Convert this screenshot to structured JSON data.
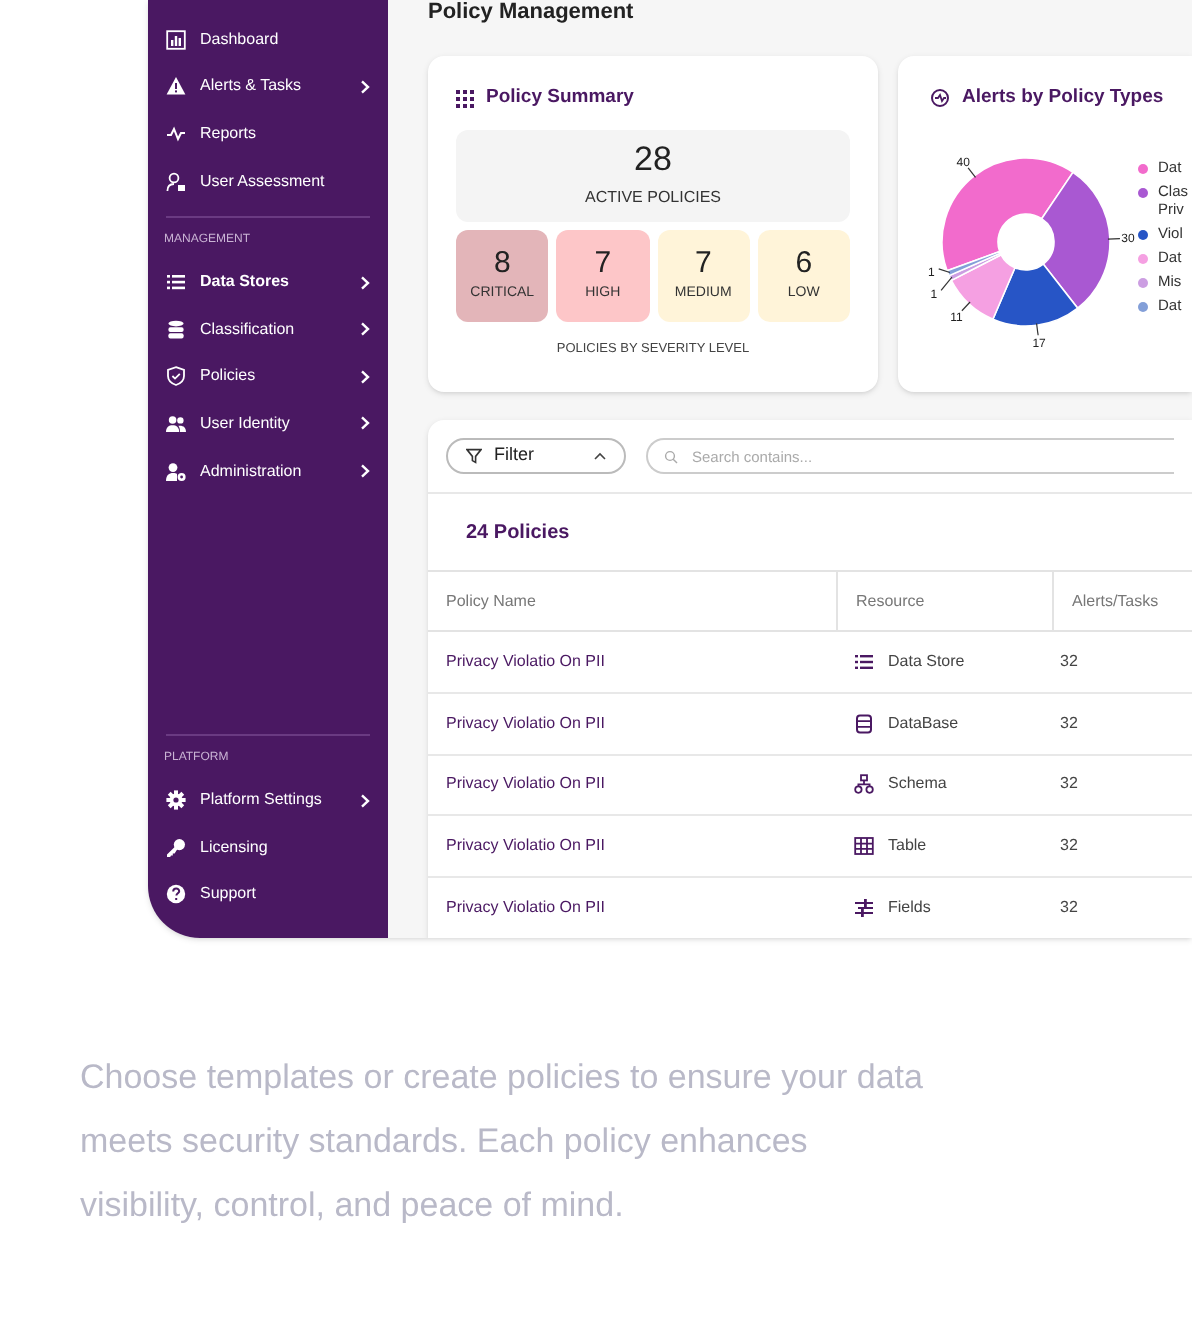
{
  "sidebar": {
    "sections": [
      {
        "items": [
          {
            "label": "Dashboard",
            "has_submenu": false,
            "selected": false
          },
          {
            "label": "Alerts & Tasks",
            "has_submenu": true,
            "selected": false
          },
          {
            "label": "Reports",
            "has_submenu": false,
            "selected": false
          },
          {
            "label": "User Assessment",
            "has_submenu": false,
            "selected": false
          }
        ]
      },
      {
        "title": "MANAGEMENT",
        "items": [
          {
            "label": "Data Stores",
            "has_submenu": true,
            "selected": true
          },
          {
            "label": "Classification",
            "has_submenu": true,
            "selected": false
          },
          {
            "label": "Policies",
            "has_submenu": true,
            "selected": false
          },
          {
            "label": "User Identity",
            "has_submenu": true,
            "selected": false
          },
          {
            "label": "Administration",
            "has_submenu": true,
            "selected": false
          }
        ]
      },
      {
        "title": "PLATFORM",
        "items": [
          {
            "label": "Platform Settings",
            "has_submenu": true,
            "selected": false
          },
          {
            "label": "Licensing",
            "has_submenu": false,
            "selected": false
          },
          {
            "label": "Support",
            "has_submenu": false,
            "selected": false
          }
        ]
      }
    ]
  },
  "page_title": "Policy Management",
  "policy_summary": {
    "title": "Policy Summary",
    "total": "28",
    "total_label": "ACTIVE POLICIES",
    "severities": [
      {
        "count": "8",
        "label": "CRITICAL",
        "color": "#e3b5b9"
      },
      {
        "count": "7",
        "label": "HIGH",
        "color": "#fdc6c8"
      },
      {
        "count": "7",
        "label": "MEDIUM",
        "color": "#fff4d9"
      },
      {
        "count": "6",
        "label": "LOW",
        "color": "#fff4d9"
      }
    ],
    "footer": "POLICIES BY SEVERITY LEVEL"
  },
  "alerts_chart": {
    "title": "Alerts by Policy Types",
    "chart_data": {
      "type": "donut",
      "categories": [
        "Dat",
        "Clas Priv",
        "Viol",
        "Dat",
        "Mis",
        "Dat"
      ],
      "values": [
        40,
        30,
        17,
        11,
        1,
        1
      ],
      "colors": [
        "#f26bcc",
        "#a958d2",
        "#2755c6",
        "#f5a0e2",
        "#cc9ee2",
        "#839fd8"
      ],
      "data_labels": true
    }
  },
  "table_panel": {
    "filter": "Filter",
    "search_placeholder": "Search contains...",
    "count": "24 Policies",
    "columns": [
      "Policy Name",
      "Resource",
      "Alerts/Tasks"
    ],
    "rows": [
      {
        "policy": "Privacy Violatio On PII",
        "resource": "Data Store",
        "alerts": "32"
      },
      {
        "policy": "Privacy Violatio On PII",
        "resource": "DataBase",
        "alerts": "32"
      },
      {
        "policy": "Privacy Violatio On PII",
        "resource": "Schema",
        "alerts": "32"
      },
      {
        "policy": "Privacy Violatio On PII",
        "resource": "Table",
        "alerts": "32"
      },
      {
        "policy": "Privacy Violatio On PII",
        "resource": "Fields",
        "alerts": "32"
      }
    ]
  },
  "description": "Choose templates or create policies to ensure your data meets security standards. Each policy enhances visibility, control, and peace of mind."
}
